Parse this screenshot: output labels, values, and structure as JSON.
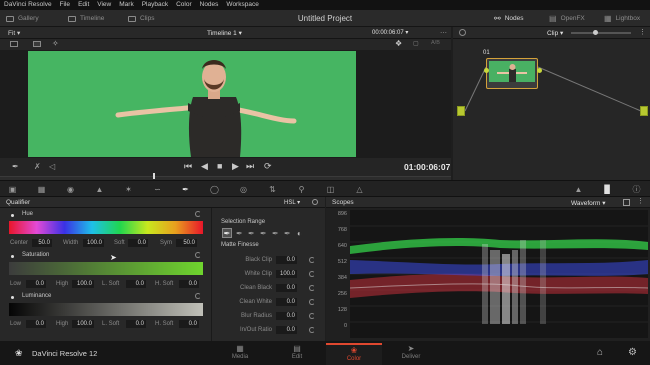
{
  "menubar": {
    "items": [
      "DaVinci Resolve",
      "File",
      "Edit",
      "View",
      "Mark",
      "Playback",
      "Color",
      "Nodes",
      "Workspace"
    ]
  },
  "toolbar": {
    "gallery": "Gallery",
    "timeline": "Timeline",
    "clips": "Clips",
    "project_title": "Untitled Project",
    "nodes": "Nodes",
    "openfx": "OpenFX",
    "lightbox": "Lightbox"
  },
  "viewer": {
    "fit": "Fit",
    "timeline_name": "Timeline 1",
    "timecode_top": "00:00:06:07",
    "ab": "A/B",
    "timecode": "01:00:06:07"
  },
  "nodes": {
    "mode": "Clip",
    "node_number": "01"
  },
  "qualifier": {
    "title": "Qualifier",
    "mode": "HSL",
    "hue": {
      "label": "Hue",
      "center_label": "Center",
      "center": "50.0",
      "width_label": "Width",
      "width": "100.0",
      "soft_label": "Soft",
      "soft": "0.0",
      "sym_label": "Sym",
      "sym": "50.0"
    },
    "saturation": {
      "label": "Saturation",
      "low_label": "Low",
      "low": "0.0",
      "high_label": "High",
      "high": "100.0",
      "lsoft_label": "L. Soft",
      "lsoft": "0.0",
      "hsoft_label": "H. Soft",
      "hsoft": "0.0"
    },
    "luminance": {
      "label": "Luminance",
      "low_label": "Low",
      "low": "0.0",
      "high_label": "High",
      "high": "100.0",
      "lsoft_label": "L. Soft",
      "lsoft": "0.0",
      "hsoft_label": "H. Soft",
      "hsoft": "0.0"
    },
    "selection_range": "Selection Range",
    "matte_finesse": "Matte Finesse",
    "matte": [
      {
        "label": "Black Clip",
        "value": "0.0"
      },
      {
        "label": "White Clip",
        "value": "100.0"
      },
      {
        "label": "Clean Black",
        "value": "0.0"
      },
      {
        "label": "Clean White",
        "value": "0.0"
      },
      {
        "label": "Blur Radius",
        "value": "0.0"
      },
      {
        "label": "In/Out Ratio",
        "value": "0.0"
      }
    ]
  },
  "scopes": {
    "title": "Scopes",
    "mode": "Waveform",
    "scale": [
      "896",
      "768",
      "640",
      "512",
      "384",
      "256",
      "128",
      "0"
    ]
  },
  "bottombar": {
    "app_name": "DaVinci Resolve 12",
    "pages": [
      "Media",
      "Edit",
      "Color",
      "Deliver"
    ],
    "active_page": "Color"
  },
  "colors": {
    "accent": "#e0482f",
    "greenscreen": "#46b562",
    "node_border": "#d4a23a",
    "connector": "#c8d83c"
  }
}
